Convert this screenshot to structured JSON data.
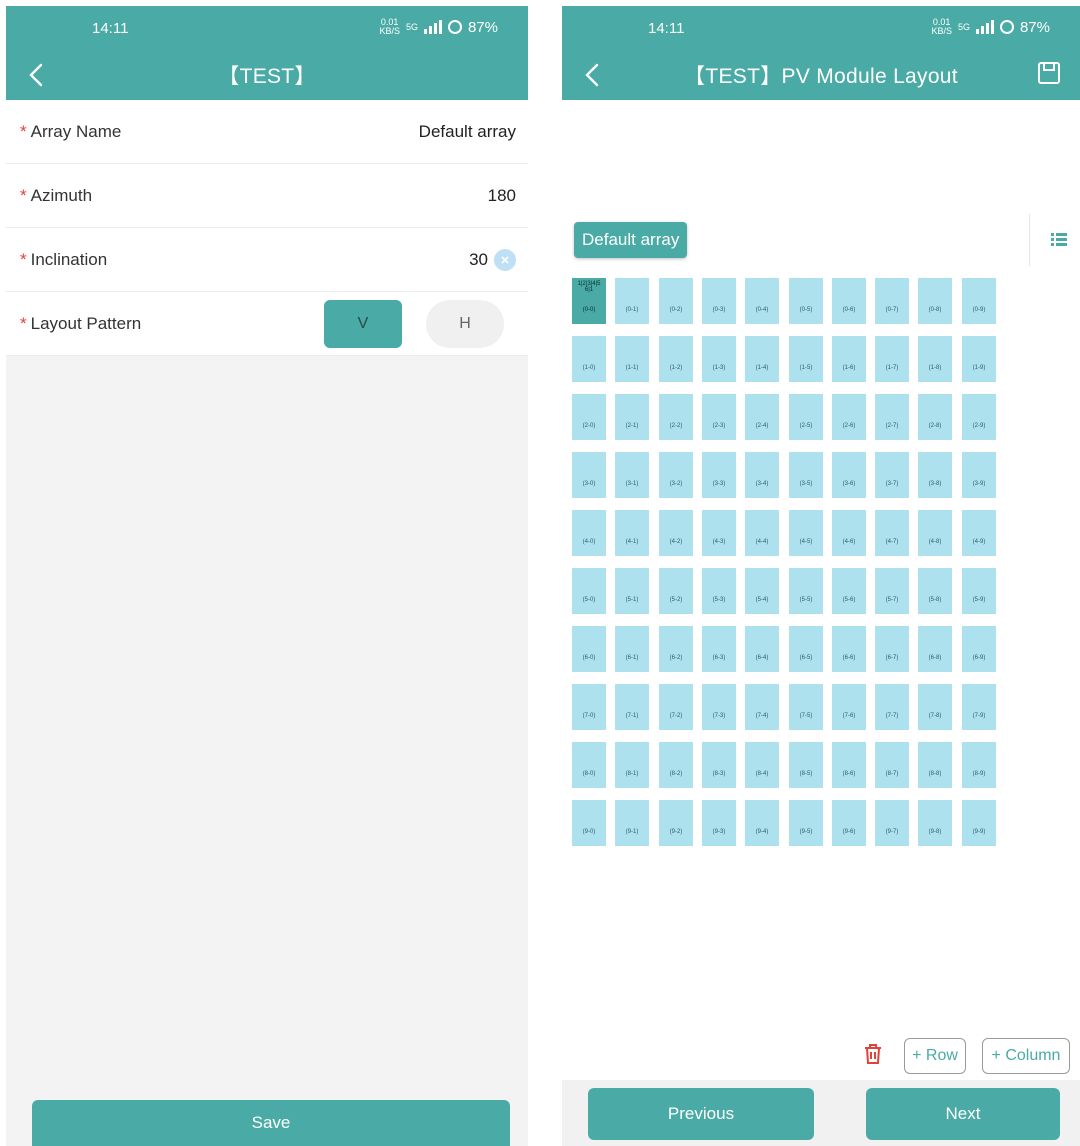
{
  "colors": {
    "primary": "#4aaba6",
    "module": "#aee1ee",
    "required": "#e2403a"
  },
  "left": {
    "status": {
      "time": "14:11",
      "net_speed": "0.01",
      "net_unit": "KB/S",
      "network": "5G",
      "battery": "87%"
    },
    "title": "【TEST】",
    "fields": [
      {
        "label": "Array Name",
        "value": "Default array"
      },
      {
        "label": "Azimuth",
        "value": "180"
      },
      {
        "label": "Inclination",
        "value": "30"
      }
    ],
    "layout_pattern": {
      "label": "Layout Pattern",
      "options": [
        "V",
        "H"
      ],
      "selected": "V"
    },
    "save_label": "Save"
  },
  "right": {
    "status": {
      "time": "14:11",
      "net_speed": "0.01",
      "net_unit": "KB/S",
      "network": "5G",
      "battery": "87%"
    },
    "title": "【TEST】PV Module Layout",
    "array_chip": "Default array",
    "grid": {
      "rows": 10,
      "cols": 10,
      "selected_cell_header": "1|2|3|4|5 6|1",
      "cell_labels": [
        [
          "(0-0)",
          "(0-1)",
          "(0-2)",
          "(0-3)",
          "(0-4)",
          "(0-5)",
          "(0-6)",
          "(0-7)",
          "(0-8)",
          "(0-9)"
        ],
        [
          "(1-0)",
          "(1-1)",
          "(1-2)",
          "(1-3)",
          "(1-4)",
          "(1-5)",
          "(1-6)",
          "(1-7)",
          "(1-8)",
          "(1-9)"
        ],
        [
          "(2-0)",
          "(2-1)",
          "(2-2)",
          "(2-3)",
          "(2-4)",
          "(2-5)",
          "(2-6)",
          "(2-7)",
          "(2-8)",
          "(2-9)"
        ],
        [
          "(3-0)",
          "(3-1)",
          "(3-2)",
          "(3-3)",
          "(3-4)",
          "(3-5)",
          "(3-6)",
          "(3-7)",
          "(3-8)",
          "(3-9)"
        ],
        [
          "(4-0)",
          "(4-1)",
          "(4-2)",
          "(4-3)",
          "(4-4)",
          "(4-5)",
          "(4-6)",
          "(4-7)",
          "(4-8)",
          "(4-9)"
        ],
        [
          "(5-0)",
          "(5-1)",
          "(5-2)",
          "(5-3)",
          "(5-4)",
          "(5-5)",
          "(5-6)",
          "(5-7)",
          "(5-8)",
          "(5-9)"
        ],
        [
          "(6-0)",
          "(6-1)",
          "(6-2)",
          "(6-3)",
          "(6-4)",
          "(6-5)",
          "(6-6)",
          "(6-7)",
          "(6-8)",
          "(6-9)"
        ],
        [
          "(7-0)",
          "(7-1)",
          "(7-2)",
          "(7-3)",
          "(7-4)",
          "(7-5)",
          "(7-6)",
          "(7-7)",
          "(7-8)",
          "(7-9)"
        ],
        [
          "(8-0)",
          "(8-1)",
          "(8-2)",
          "(8-3)",
          "(8-4)",
          "(8-5)",
          "(8-6)",
          "(8-7)",
          "(8-8)",
          "(8-9)"
        ],
        [
          "(9-0)",
          "(9-1)",
          "(9-2)",
          "(9-3)",
          "(9-4)",
          "(9-5)",
          "(9-6)",
          "(9-7)",
          "(9-8)",
          "(9-9)"
        ]
      ]
    },
    "add_row_label": "+ Row",
    "add_column_label": "+ Column",
    "previous_label": "Previous",
    "next_label": "Next"
  }
}
